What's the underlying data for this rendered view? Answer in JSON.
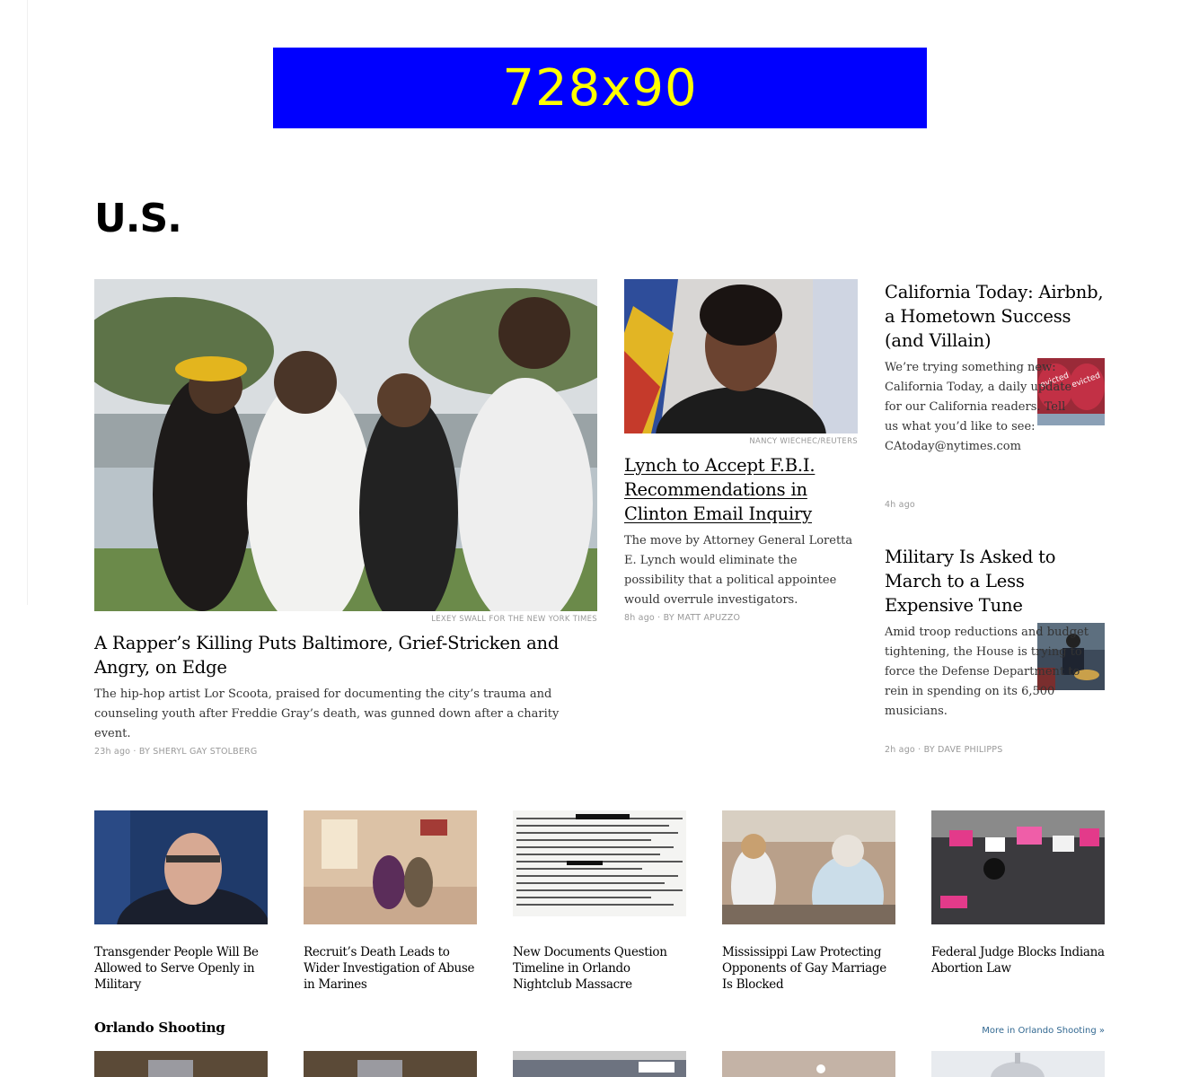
{
  "ad": {
    "label": "728x90"
  },
  "section": {
    "title": "U.S."
  },
  "lead": {
    "credit": "LEXEY SWALL FOR THE NEW YORK TIMES",
    "headline": "A Rapper’s Killing Puts Baltimore, Grief-Stricken and Angry, on Edge",
    "summary": "The hip-hop artist Lor Scoota, praised for documenting the city’s trauma and counseling youth after Freddie Gray’s death, was gunned down after a charity event.",
    "time": "23h ago",
    "byline": "By SHERYL GAY STOLBERG"
  },
  "second": {
    "credit": "NANCY WIECHEC/REUTERS",
    "headline": "Lynch to Accept F.B.I. Recommendations in Clinton Email Inquiry",
    "summary": "The move by Attorney General Loretta E. Lynch would eliminate the possibility that a political appointee would overrule investigators.",
    "time": "8h ago",
    "byline": "By MATT APUZZO"
  },
  "third": [
    {
      "headline": "California Today: Airbnb, a Hometown Success (and Villain)",
      "summary": "We’re trying something new: California Today, a daily update for our California readers. Tell us what you’d like to see: CAtoday@nytimes.com",
      "time": "4h ago",
      "byline": ""
    },
    {
      "headline": "Military Is Asked to March to a Less Expensive Tune",
      "summary": "Amid troop reductions and budget tightening, the House is trying to force the Defense Department to rein in spending on its 6,500 musicians.",
      "time": "2h ago",
      "byline": "By DAVE PHILIPPS"
    }
  ],
  "row": [
    {
      "title": "Transgender People Will Be Allowed to Serve Openly in Military"
    },
    {
      "title": "Recruit’s Death Leads to Wider Investigation of Abuse in Marines"
    },
    {
      "title": "New Documents Question Timeline in Orlando Nightclub Massacre"
    },
    {
      "title": "Mississippi Law Protecting Opponents of Gay Marriage Is Blocked"
    },
    {
      "title": "Federal Judge Blocks Indiana Abortion Law"
    }
  ],
  "subsection": {
    "title": "Orlando Shooting",
    "more": "More in Orlando Shooting »"
  },
  "colors": {
    "ad_bg": "#0000ff",
    "ad_text": "#ffff00",
    "link": "#326891"
  }
}
